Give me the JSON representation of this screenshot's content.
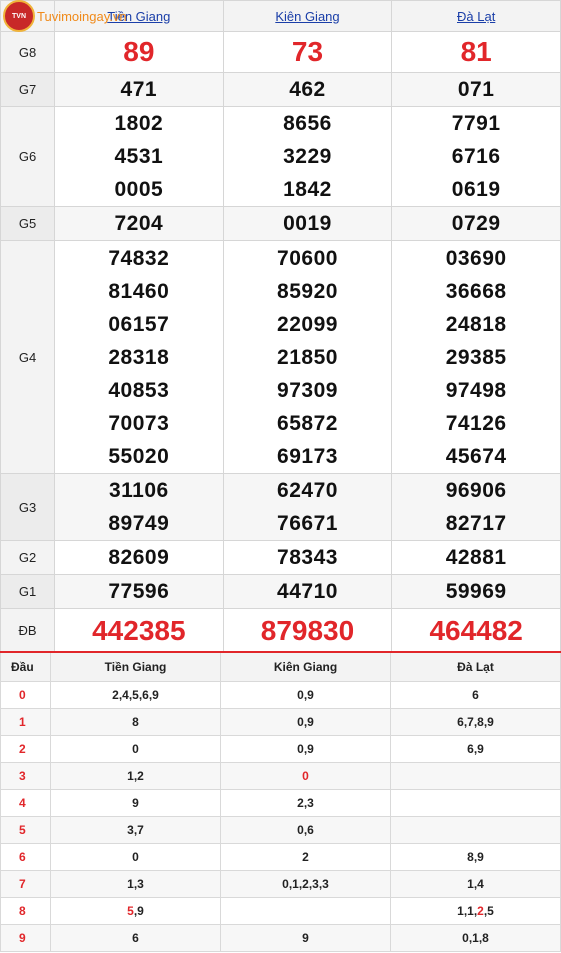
{
  "logo": {
    "badge": "TVN",
    "text": "Tuvimoingay.vn"
  },
  "provinces": [
    "Tiền Giang",
    "Kiên Giang",
    "Đà Lạt"
  ],
  "prizes": [
    {
      "label": "G8",
      "style": "big-red",
      "values": [
        [
          "89"
        ],
        [
          "73"
        ],
        [
          "81"
        ]
      ]
    },
    {
      "label": "G7",
      "style": "num",
      "values": [
        [
          "471"
        ],
        [
          "462"
        ],
        [
          "071"
        ]
      ]
    },
    {
      "label": "G6",
      "style": "num",
      "values": [
        [
          "1802",
          "4531",
          "0005"
        ],
        [
          "8656",
          "3229",
          "1842"
        ],
        [
          "7791",
          "6716",
          "0619"
        ]
      ]
    },
    {
      "label": "G5",
      "style": "num",
      "values": [
        [
          "7204"
        ],
        [
          "0019"
        ],
        [
          "0729"
        ]
      ]
    },
    {
      "label": "G4",
      "style": "num",
      "values": [
        [
          "74832",
          "81460",
          "06157",
          "28318",
          "40853",
          "70073",
          "55020"
        ],
        [
          "70600",
          "85920",
          "22099",
          "21850",
          "97309",
          "65872",
          "69173"
        ],
        [
          "03690",
          "36668",
          "24818",
          "29385",
          "97498",
          "74126",
          "45674"
        ]
      ]
    },
    {
      "label": "G3",
      "style": "num",
      "values": [
        [
          "31106",
          "89749"
        ],
        [
          "62470",
          "76671"
        ],
        [
          "96906",
          "82717"
        ]
      ]
    },
    {
      "label": "G2",
      "style": "num",
      "values": [
        [
          "82609"
        ],
        [
          "78343"
        ],
        [
          "42881"
        ]
      ]
    },
    {
      "label": "G1",
      "style": "num",
      "values": [
        [
          "77596"
        ],
        [
          "44710"
        ],
        [
          "59969"
        ]
      ]
    },
    {
      "label": "ĐB",
      "style": "huge-red",
      "values": [
        [
          "442385"
        ],
        [
          "879830"
        ],
        [
          "464482"
        ]
      ]
    }
  ],
  "loto": {
    "header": [
      "Đầu",
      "Tiền Giang",
      "Kiên Giang",
      "Đà Lạt"
    ],
    "rows": [
      {
        "head": "0",
        "cells": [
          [
            {
              "t": "2,4,5,6,9"
            }
          ],
          [
            {
              "t": "0,9"
            }
          ],
          [
            {
              "t": "6"
            }
          ]
        ]
      },
      {
        "head": "1",
        "cells": [
          [
            {
              "t": "8"
            }
          ],
          [
            {
              "t": "0,9"
            }
          ],
          [
            {
              "t": "6,7,8,9"
            }
          ]
        ]
      },
      {
        "head": "2",
        "cells": [
          [
            {
              "t": "0"
            }
          ],
          [
            {
              "t": "0,9"
            }
          ],
          [
            {
              "t": "6,9"
            }
          ]
        ]
      },
      {
        "head": "3",
        "cells": [
          [
            {
              "t": "1,2"
            }
          ],
          [
            {
              "t": "0",
              "red": true
            }
          ],
          []
        ]
      },
      {
        "head": "4",
        "cells": [
          [
            {
              "t": "9"
            }
          ],
          [
            {
              "t": "2,3"
            }
          ],
          []
        ]
      },
      {
        "head": "5",
        "cells": [
          [
            {
              "t": "3,7"
            }
          ],
          [
            {
              "t": "0,6"
            }
          ],
          []
        ]
      },
      {
        "head": "6",
        "cells": [
          [
            {
              "t": "0"
            }
          ],
          [
            {
              "t": "2"
            }
          ],
          [
            {
              "t": "8,9"
            }
          ]
        ]
      },
      {
        "head": "7",
        "cells": [
          [
            {
              "t": "1,3"
            }
          ],
          [
            {
              "t": "0,1,2,3,3"
            }
          ],
          [
            {
              "t": "1,4"
            }
          ]
        ]
      },
      {
        "head": "8",
        "cells": [
          [
            {
              "t": "5",
              "red": true
            },
            {
              "t": ",9"
            }
          ],
          [],
          [
            {
              "t": "1,1,"
            },
            {
              "t": "2",
              "red": true
            },
            {
              "t": ",5"
            }
          ]
        ]
      },
      {
        "head": "9",
        "cells": [
          [
            {
              "t": "6"
            }
          ],
          [
            {
              "t": "9"
            }
          ],
          [
            {
              "t": "0,1,8"
            }
          ]
        ]
      }
    ]
  }
}
